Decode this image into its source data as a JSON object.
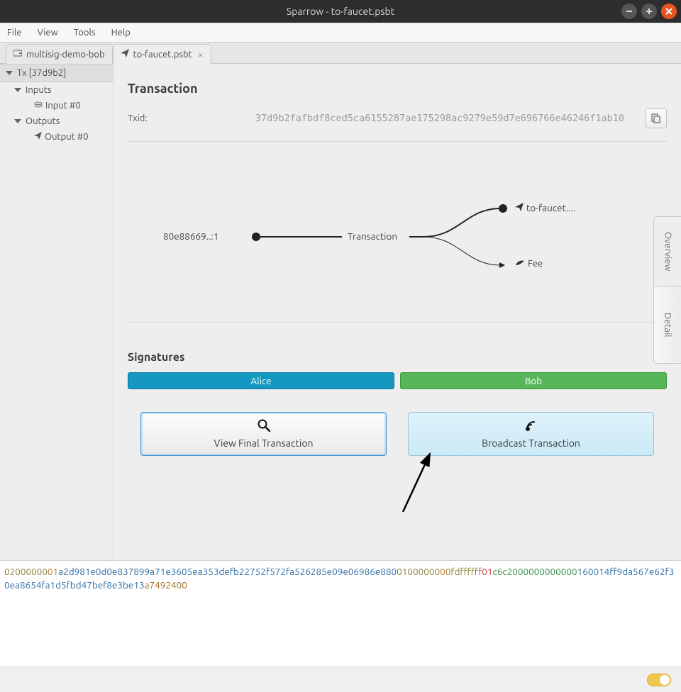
{
  "window": {
    "title": "Sparrow - to-faucet.psbt"
  },
  "menu": {
    "file": "File",
    "view": "View",
    "tools": "Tools",
    "help": "Help"
  },
  "tabs": {
    "wallet": "multisig-demo-bob",
    "psbt": "to-faucet.psbt"
  },
  "tree": {
    "tx_header": "Tx [37d9b2]",
    "inputs": "Inputs",
    "input0": "Input #0",
    "outputs": "Outputs",
    "output0": "Output #0"
  },
  "transaction": {
    "heading": "Transaction",
    "txid_label": "Txid:",
    "txid": "37d9b2fafbdf8ced5ca6155287ae175298ac9279e59d7e696766e46246f1ab10"
  },
  "diagram": {
    "input": "80e88669..:1",
    "center": "Transaction",
    "out1": "to-faucet....",
    "out2": "Fee"
  },
  "side_tabs": {
    "overview": "Overview",
    "detail": "Detail"
  },
  "signatures": {
    "heading": "Signatures",
    "alice": "Alice",
    "bob": "Bob"
  },
  "buttons": {
    "view_final": "View Final Transaction",
    "broadcast": "Broadcast Transaction"
  },
  "hex": {
    "s1": "02000000",
    "s2": "01",
    "s3": "a2d981e0d0e837899a71e3605ea353defb22752f572fa526285e09e06986e880",
    "s4": "01000000",
    "s5": "00",
    "s6": "fdffffff",
    "s7": "01",
    "s8": "c6c2000000000000",
    "s9": "160014ff9da567e62f30ea8654fa1d5fbd47bef8e3be13",
    "s10": "a7492400"
  }
}
